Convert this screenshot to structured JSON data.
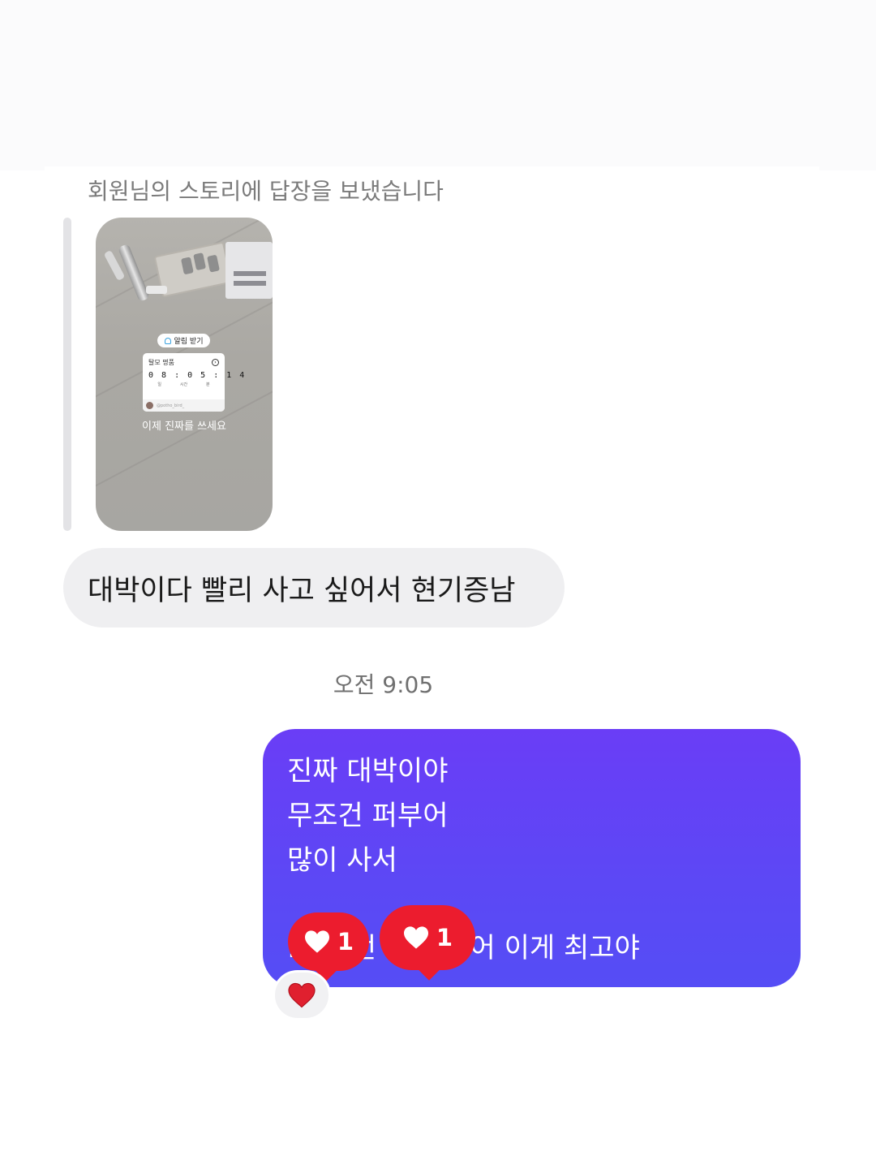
{
  "story_reply": {
    "caption": "회원님의 스토리에 답장을 보냈습니다",
    "story": {
      "alert_label": "알림 받기",
      "countdown_title": "탈모 명품",
      "countdown_time": "0 8 : 0 5 : 1 4",
      "countdown_units": [
        "일",
        "시간",
        "분"
      ],
      "handle": "@potho_bird_",
      "caption": "이제 진짜를 쓰세요"
    }
  },
  "received_message": "대박이다 빨리 사고 싶어서 현기증남",
  "timestamp": "오전 9:05",
  "sent_message": {
    "lines": [
      "진짜 대박이야",
      "무조건 퍼부어",
      "많이 사서",
      "",
      "…… 던 다 써봤어 이게 최고야"
    ]
  },
  "like_badges": [
    {
      "count": "1"
    },
    {
      "count": "1"
    }
  ],
  "reaction": {
    "emoji": "❤️"
  },
  "colors": {
    "sent_bubble": "#5c48f5",
    "received_bubble": "#efeff1",
    "like_badge": "#ec1c2e"
  }
}
